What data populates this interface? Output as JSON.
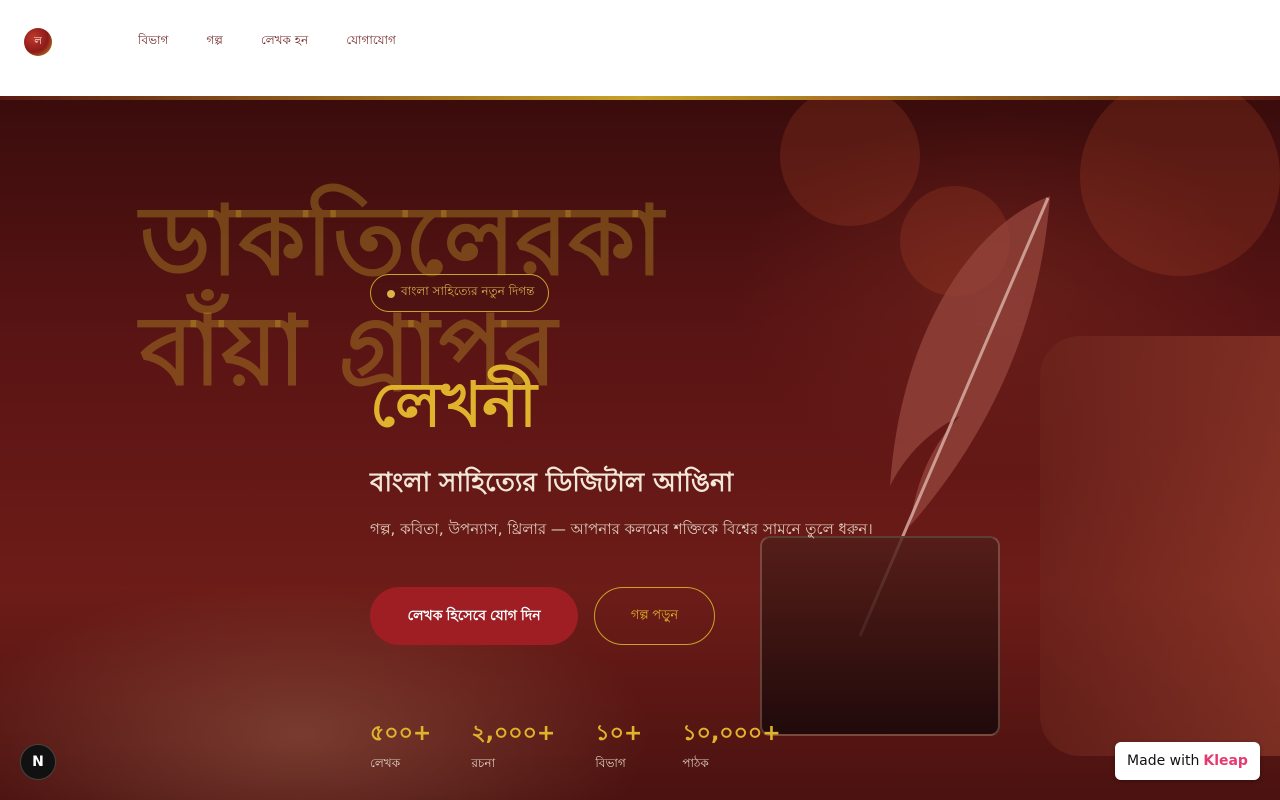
{
  "header": {
    "logo_text": "ল",
    "nav": [
      "বিভাগ",
      "গল্প",
      "লেখক হন",
      "যোগাযোগ"
    ]
  },
  "hero": {
    "background_script": [
      "ডাকতিলেরকা",
      "বাঁয়া গ্রাপর"
    ],
    "badge": "বাংলা সাহিত্যের নতুন দিগন্ত",
    "title": "লেখনী",
    "subtitle": "বাংলা সাহিত্যের ডিজিটাল আঙিনা",
    "description": "গল্প, কবিতা, উপন্যাস, থ্রিলার — আপনার কলমের শক্তিকে বিশ্বের সামনে তুলে ধরুন।",
    "primary_button": "লেখক হিসেবে যোগ দিন",
    "secondary_button": "গল্প পড়ুন",
    "stats": [
      {
        "value": "৫০০+",
        "label": "লেখক"
      },
      {
        "value": "২,০০০+",
        "label": "রচনা"
      },
      {
        "value": "১০+",
        "label": "বিভাগ"
      },
      {
        "value": "১০,০০০+",
        "label": "পাঠক"
      }
    ]
  },
  "footer_widgets": {
    "next_badge": "N",
    "made_with_prefix": "Made with",
    "made_with_brand": "Kleap"
  },
  "colors": {
    "accent_gold": "#e0b32c",
    "primary_red": "#9e1e24",
    "hero_dark": "#5a1414",
    "nav_text": "#6b1f1f",
    "brand_pink": "#e63970"
  }
}
